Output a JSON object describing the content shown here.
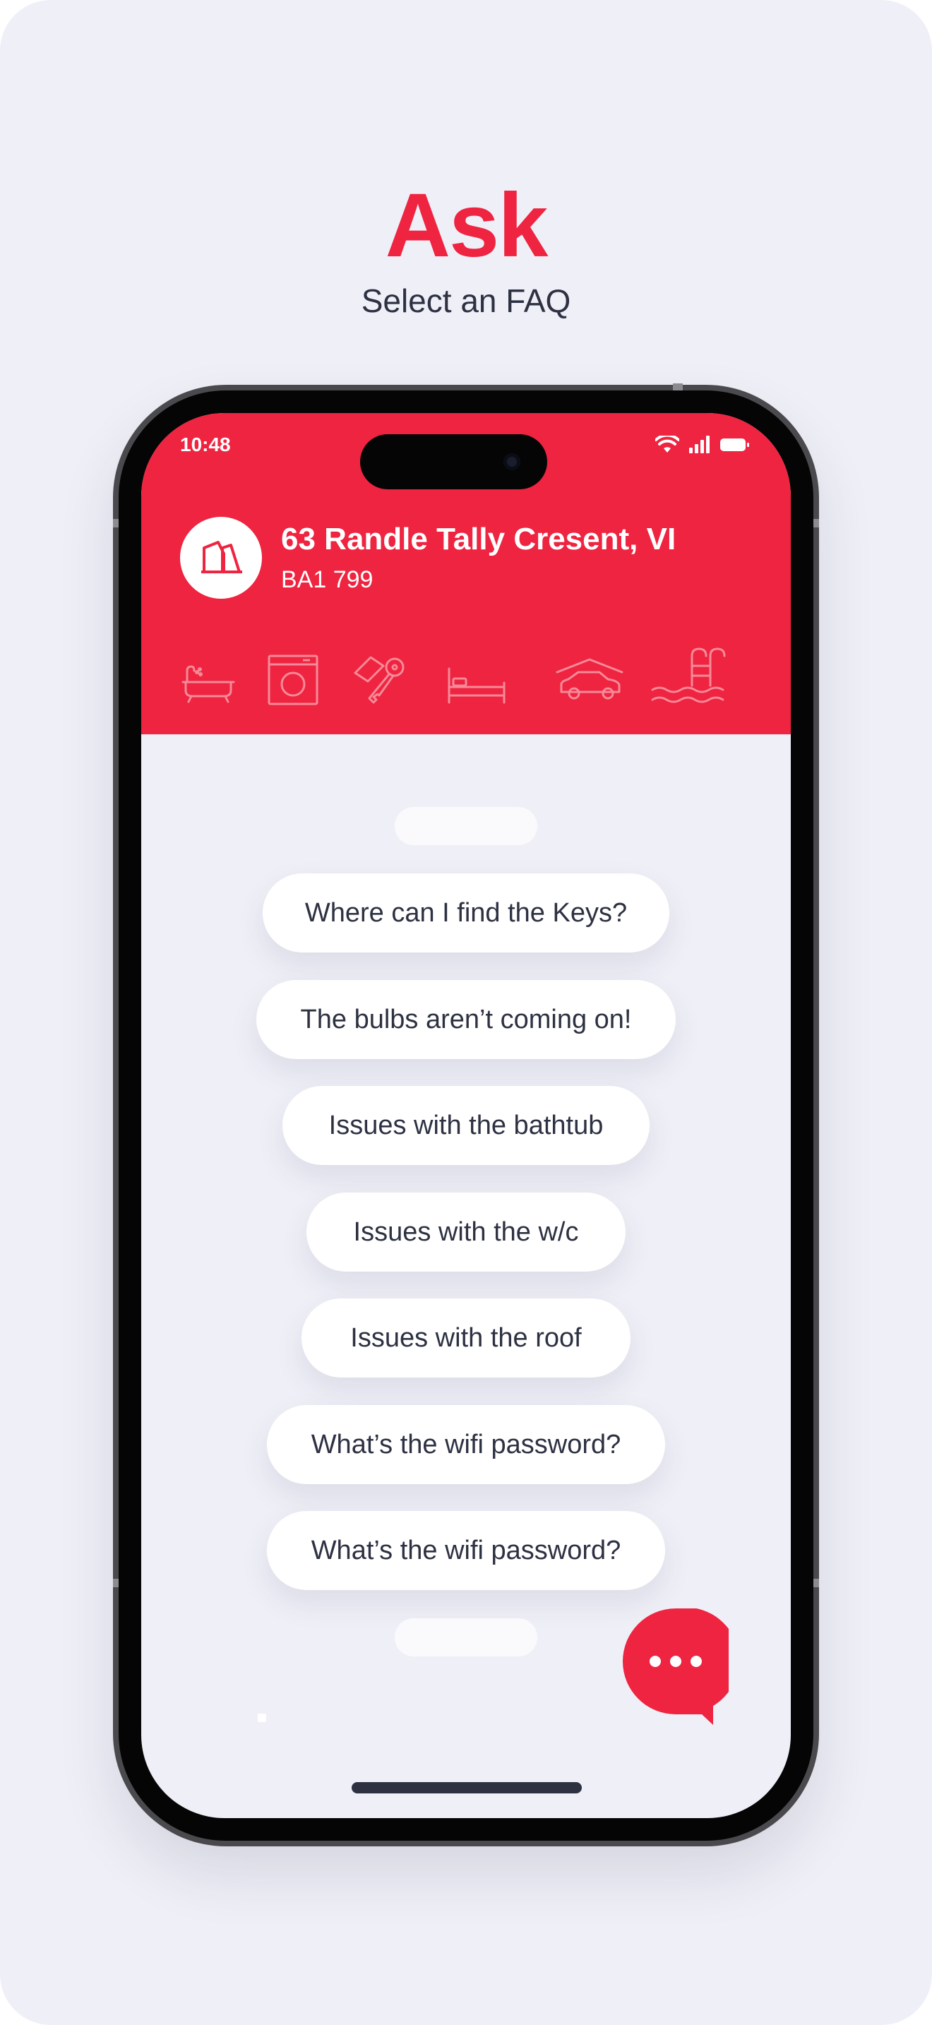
{
  "page": {
    "title": "Ask",
    "subtitle": "Select an FAQ"
  },
  "status_bar": {
    "time": "10:48",
    "icons": [
      "wifi-icon",
      "cellular-signal-icon",
      "battery-icon"
    ]
  },
  "property": {
    "address": "63 Randle Tally Cresent, VI",
    "postcode": "BA1 799",
    "logo_icon": "house-logo-icon"
  },
  "categories": [
    {
      "name": "bathtub-icon"
    },
    {
      "name": "washing-machine-icon"
    },
    {
      "name": "keys-icon"
    },
    {
      "name": "bed-icon"
    },
    {
      "name": "car-garage-icon"
    },
    {
      "name": "pool-ladder-icon"
    }
  ],
  "faqs": [
    "Where can I find the Keys?",
    "The bulbs aren’t coming on!",
    "Issues with the bathtub",
    "Issues with the w/c",
    "Issues with the roof",
    "What’s the wifi password?",
    "What’s the wifi password?"
  ],
  "chat_button": {
    "icon": "chat-bubble-icon"
  },
  "colors": {
    "accent": "#ee2440",
    "background": "#efeff7",
    "text_dark": "#2d3142",
    "pill": "#ffffff"
  }
}
